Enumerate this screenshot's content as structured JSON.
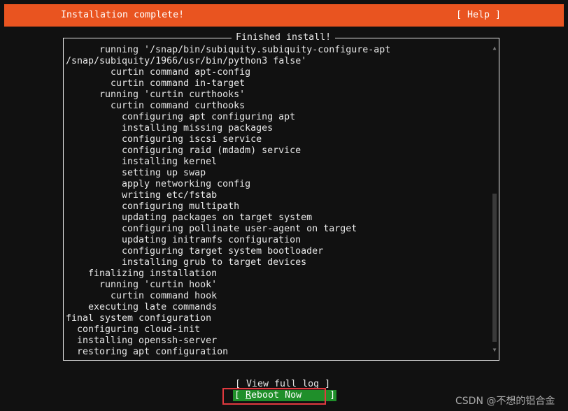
{
  "header": {
    "title": "Installation complete!",
    "help_label": "[ Help ]",
    "color": "#e95420"
  },
  "panel": {
    "title": "Finished install!",
    "log": [
      {
        "indent": 6,
        "text": "running '/snap/bin/subiquity.subiquity-configure-apt"
      },
      {
        "indent": 0,
        "text": "/snap/subiquity/1966/usr/bin/python3 false'"
      },
      {
        "indent": 8,
        "text": "curtin command apt-config"
      },
      {
        "indent": 8,
        "text": "curtin command in-target"
      },
      {
        "indent": 6,
        "text": "running 'curtin curthooks'"
      },
      {
        "indent": 8,
        "text": "curtin command curthooks"
      },
      {
        "indent": 10,
        "text": "configuring apt configuring apt"
      },
      {
        "indent": 10,
        "text": "installing missing packages"
      },
      {
        "indent": 10,
        "text": "configuring iscsi service"
      },
      {
        "indent": 10,
        "text": "configuring raid (mdadm) service"
      },
      {
        "indent": 10,
        "text": "installing kernel"
      },
      {
        "indent": 10,
        "text": "setting up swap"
      },
      {
        "indent": 10,
        "text": "apply networking config"
      },
      {
        "indent": 10,
        "text": "writing etc/fstab"
      },
      {
        "indent": 10,
        "text": "configuring multipath"
      },
      {
        "indent": 10,
        "text": "updating packages on target system"
      },
      {
        "indent": 10,
        "text": "configuring pollinate user-agent on target"
      },
      {
        "indent": 10,
        "text": "updating initramfs configuration"
      },
      {
        "indent": 10,
        "text": "configuring target system bootloader"
      },
      {
        "indent": 10,
        "text": "installing grub to target devices"
      },
      {
        "indent": 4,
        "text": "finalizing installation"
      },
      {
        "indent": 6,
        "text": "running 'curtin hook'"
      },
      {
        "indent": 8,
        "text": "curtin command hook"
      },
      {
        "indent": 4,
        "text": "executing late commands"
      },
      {
        "indent": 0,
        "text": "final system configuration"
      },
      {
        "indent": 2,
        "text": "configuring cloud-init"
      },
      {
        "indent": 2,
        "text": "installing openssh-server"
      },
      {
        "indent": 2,
        "text": "restoring apt configuration"
      }
    ],
    "scroll_position": {
      "thumb_start": 0.48,
      "thumb_end": 0.98
    }
  },
  "buttons": {
    "view_log": "[ View full log ]",
    "reboot_prefix": "[ ",
    "reboot_hotkey": "R",
    "reboot_rest": "eboot Now     ]",
    "reboot_color": "#1f8f2a"
  },
  "watermark": "CSDN @不想的铝合金"
}
